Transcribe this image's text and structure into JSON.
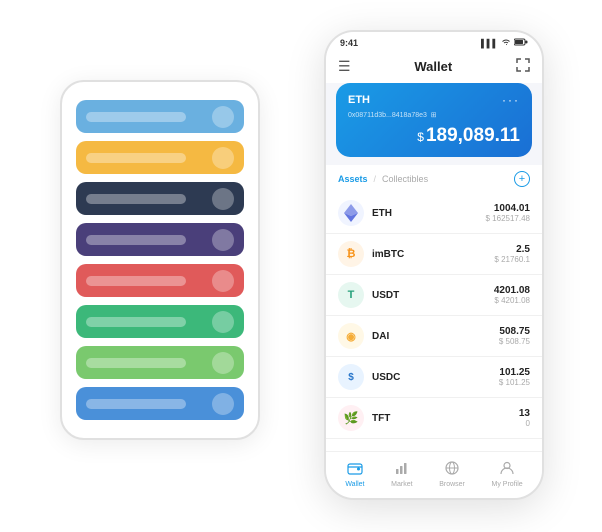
{
  "scene": {
    "bg_phone": {
      "cards": [
        {
          "color": "#6ab0e0",
          "dot_color": "rgba(255,255,255,0.3)"
        },
        {
          "color": "#f5b942",
          "dot_color": "rgba(255,255,255,0.3)"
        },
        {
          "color": "#2d3a52",
          "dot_color": "rgba(255,255,255,0.3)"
        },
        {
          "color": "#4a3f7a",
          "dot_color": "rgba(255,255,255,0.3)"
        },
        {
          "color": "#e05a5a",
          "dot_color": "rgba(255,255,255,0.3)"
        },
        {
          "color": "#3cb87a",
          "dot_color": "rgba(255,255,255,0.3)"
        },
        {
          "color": "#7ac96e",
          "dot_color": "rgba(255,255,255,0.3)"
        },
        {
          "color": "#4a90d9",
          "dot_color": "rgba(255,255,255,0.3)"
        }
      ]
    },
    "fg_phone": {
      "status_bar": {
        "time": "9:41",
        "icons": [
          "▌▌▌",
          "wifi",
          "battery"
        ]
      },
      "nav": {
        "menu_icon": "☰",
        "title": "Wallet",
        "expand_icon": "⛶"
      },
      "wallet_card": {
        "coin": "ETH",
        "address": "0x08711d3b...8418a78e3",
        "address_icon": "⊞",
        "dots": "...",
        "balance_symbol": "$",
        "balance": "189,089.11"
      },
      "assets_section": {
        "tab_active": "Assets",
        "tab_divider": "/",
        "tab_inactive": "Collectibles",
        "add_icon": "+"
      },
      "assets": [
        {
          "symbol": "ETH",
          "icon": "◆",
          "icon_class": "icon-eth",
          "amount": "1004.01",
          "usd": "$ 162517.48"
        },
        {
          "symbol": "imBTC",
          "icon": "Ⓑ",
          "icon_class": "icon-imbtc",
          "amount": "2.5",
          "usd": "$ 21760.1"
        },
        {
          "symbol": "USDT",
          "icon": "T",
          "icon_class": "icon-usdt",
          "amount": "4201.08",
          "usd": "$ 4201.08"
        },
        {
          "symbol": "DAI",
          "icon": "◉",
          "icon_class": "icon-dai",
          "amount": "508.75",
          "usd": "$ 508.75"
        },
        {
          "symbol": "USDC",
          "icon": "$",
          "icon_class": "icon-usdc",
          "amount": "101.25",
          "usd": "$ 101.25"
        },
        {
          "symbol": "TFT",
          "icon": "🌿",
          "icon_class": "icon-tft",
          "amount": "13",
          "usd": "0"
        }
      ],
      "bottom_nav": [
        {
          "label": "Wallet",
          "icon": "◎",
          "active": true
        },
        {
          "label": "Market",
          "icon": "📊",
          "active": false
        },
        {
          "label": "Browser",
          "icon": "👤",
          "active": false
        },
        {
          "label": "My Profile",
          "icon": "👤",
          "active": false
        }
      ]
    }
  }
}
